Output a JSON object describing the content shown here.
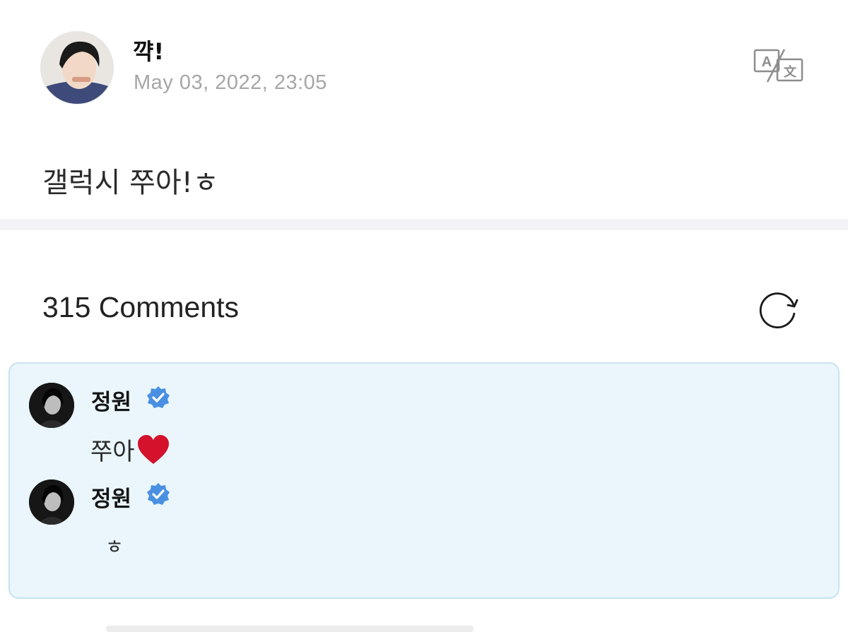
{
  "post": {
    "author": {
      "name": "꺅!",
      "avatar_icon": "profile-photo"
    },
    "date": "May 03, 2022, 23:05",
    "body": "갤럭시 쭈아!ㅎ",
    "translate_icon": "translate-icon"
  },
  "comments_section": {
    "title": "315 Comments",
    "refresh_icon": "refresh-icon"
  },
  "comments": [
    {
      "author": "정원",
      "verified": true,
      "text": "쭈아",
      "emoji": "heart"
    },
    {
      "author": "정원",
      "verified": true,
      "text": "ㅎ"
    }
  ],
  "colors": {
    "verified": "#4a90e2",
    "panel_bg": "#eaf6fc",
    "panel_border": "#c9e3ee",
    "date": "#a6a6a6",
    "heart": "#d4122b"
  }
}
